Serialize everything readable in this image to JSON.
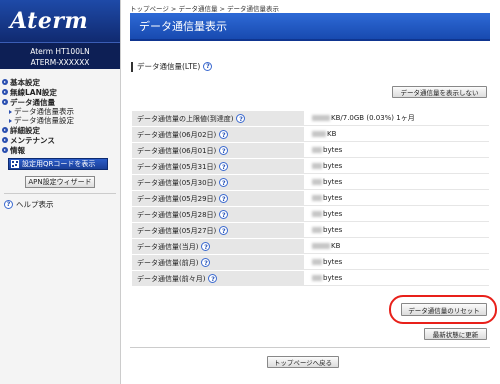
{
  "sidebar": {
    "logo": "Aterm",
    "model_line1": "Aterm  HT100LN",
    "model_line2": "ATERM-XXXXXX",
    "nav": [
      {
        "label": "基本設定"
      },
      {
        "label": "無線LAN設定"
      },
      {
        "label": "データ通信量"
      }
    ],
    "sub": [
      {
        "label": "データ通信量表示"
      },
      {
        "label": "データ通信量設定"
      }
    ],
    "nav2": [
      {
        "label": "詳細設定"
      },
      {
        "label": "メンテナンス"
      },
      {
        "label": "情報"
      }
    ],
    "qr_button": "設定用QRコードを表示",
    "apn_button": "APN設定ウィザード",
    "help": "ヘルプ表示"
  },
  "main": {
    "breadcrumb": "トップページ > データ通信量 > データ通信量表示",
    "title": "データ通信量表示",
    "section_title": "データ通信量(LTE)",
    "hide_button": "データ通信量を表示しない",
    "rows": [
      {
        "label": "データ通信量の上限値(到達度)",
        "value": "KB/7.0GB (0.03%) 1ヶ月"
      },
      {
        "label": "データ通信量(06月02日)",
        "value": "KB"
      },
      {
        "label": "データ通信量(06月01日)",
        "value": "bytes"
      },
      {
        "label": "データ通信量(05月31日)",
        "value": "bytes"
      },
      {
        "label": "データ通信量(05月30日)",
        "value": "bytes"
      },
      {
        "label": "データ通信量(05月29日)",
        "value": "bytes"
      },
      {
        "label": "データ通信量(05月28日)",
        "value": "bytes"
      },
      {
        "label": "データ通信量(05月27日)",
        "value": "bytes"
      },
      {
        "label": "データ通信量(当月)",
        "value": "KB"
      },
      {
        "label": "データ通信量(前月)",
        "value": "bytes"
      },
      {
        "label": "データ通信量(前々月)",
        "value": "bytes"
      }
    ],
    "reset_button": "データ通信量のリセット",
    "refresh_button": "最新状態に更新",
    "top_button": "トップページへ戻る"
  },
  "colors": {
    "title_bar": "#1e57c4",
    "sidebar_dark": "#0d1f55",
    "highlight": "#e8201a"
  },
  "icons": {
    "help": "question-icon",
    "nav_bullet": "arrow-bullet-icon"
  }
}
